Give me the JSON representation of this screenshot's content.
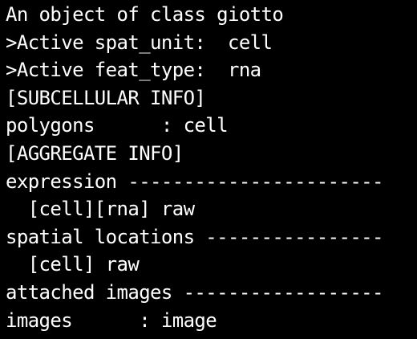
{
  "theme": {
    "background": "#000000",
    "foreground": "#ffffff"
  },
  "console": {
    "lines": [
      "An object of class giotto",
      ">Active spat_unit:  cell",
      ">Active feat_type:  rna",
      "[SUBCELLULAR INFO]",
      "polygons      : cell",
      "[AGGREGATE INFO]",
      "expression -----------------------",
      "  [cell][rna] raw",
      "spatial locations ----------------",
      "  [cell] raw",
      "attached images ------------------",
      "images      : image"
    ]
  }
}
